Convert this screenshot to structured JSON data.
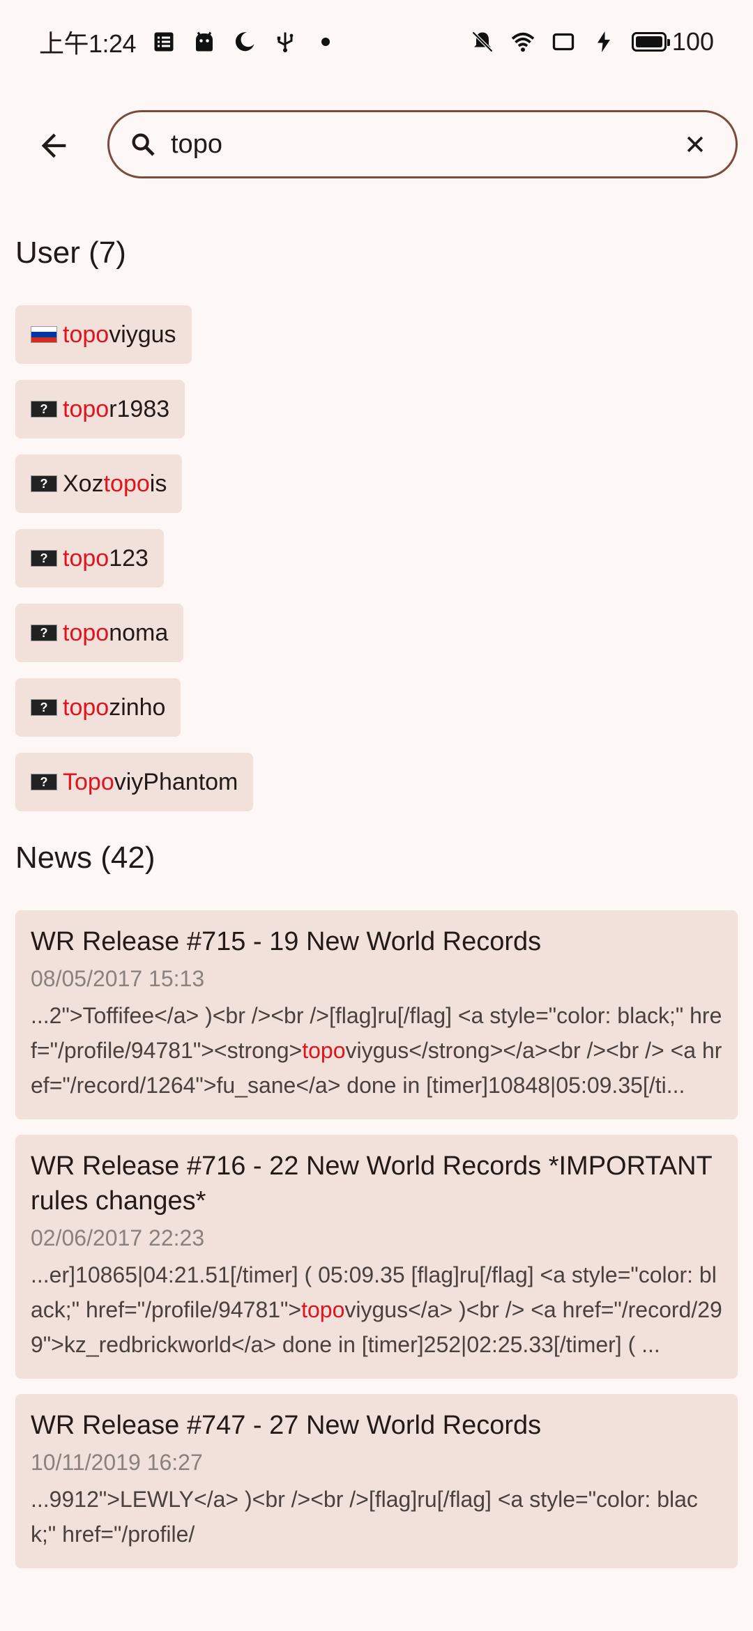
{
  "status_bar": {
    "time": "上午1:24",
    "battery": "100",
    "icons_left": [
      "notes-icon",
      "android-icon",
      "moon-icon",
      "usb-icon",
      "dot-icon"
    ],
    "icons_right": [
      "mute-icon",
      "wifi-icon",
      "cast-icon",
      "charging-icon",
      "battery-icon"
    ]
  },
  "search": {
    "value": "topo",
    "placeholder": ""
  },
  "users": {
    "header": "User (7)",
    "items": [
      {
        "flag": "ru",
        "pre": "",
        "match": "topo",
        "post": "viygus"
      },
      {
        "flag": "unknown",
        "pre": "",
        "match": "topo",
        "post": "r1983"
      },
      {
        "flag": "unknown",
        "pre": "Xoz",
        "match": "topo",
        "post": "is"
      },
      {
        "flag": "unknown",
        "pre": "",
        "match": "topo",
        "post": "123"
      },
      {
        "flag": "unknown",
        "pre": "",
        "match": "topo",
        "post": "noma"
      },
      {
        "flag": "unknown",
        "pre": "",
        "match": "topo",
        "post": "zinho"
      },
      {
        "flag": "unknown",
        "pre": "",
        "match": "Topo",
        "post": "viyPhantom"
      }
    ]
  },
  "news": {
    "header": "News (42)",
    "items": [
      {
        "title": "WR Release #715 - 19 New World Records",
        "date": "08/05/2017 15:13",
        "pre": "...2\">Toffifee</a> )<br /><br />[flag]ru[/flag] <a style=\"color: black;\" href=\"/profile/94781\"><strong>",
        "match": "topo",
        "post": "viygus</strong></a><br /><br /> <a href=\"/record/1264\">fu_sane</a> done in [timer]10848|05:09.35[/ti..."
      },
      {
        "title": "WR Release #716 - 22 New World Records *IMPORTANT rules changes*",
        "date": "02/06/2017 22:23",
        "pre": "...er]10865|04:21.51[/timer] ( 05:09.35 [flag]ru[/flag] <a style=\"color: black;\" href=\"/profile/94781\">",
        "match": "topo",
        "post": "viygus</a> )<br /> <a href=\"/record/299\">kz_redbrickworld</a> done in [timer]252|02:25.33[/timer] ( ..."
      },
      {
        "title": "WR Release #747 - 27 New World Records",
        "date": "10/11/2019 16:27",
        "pre": "...9912\">LEWLY</a> )<br /><br />[flag]ru[/flag] <a style=\"color: black;\" href=\"/profile/",
        "match": "",
        "post": ""
      }
    ]
  }
}
